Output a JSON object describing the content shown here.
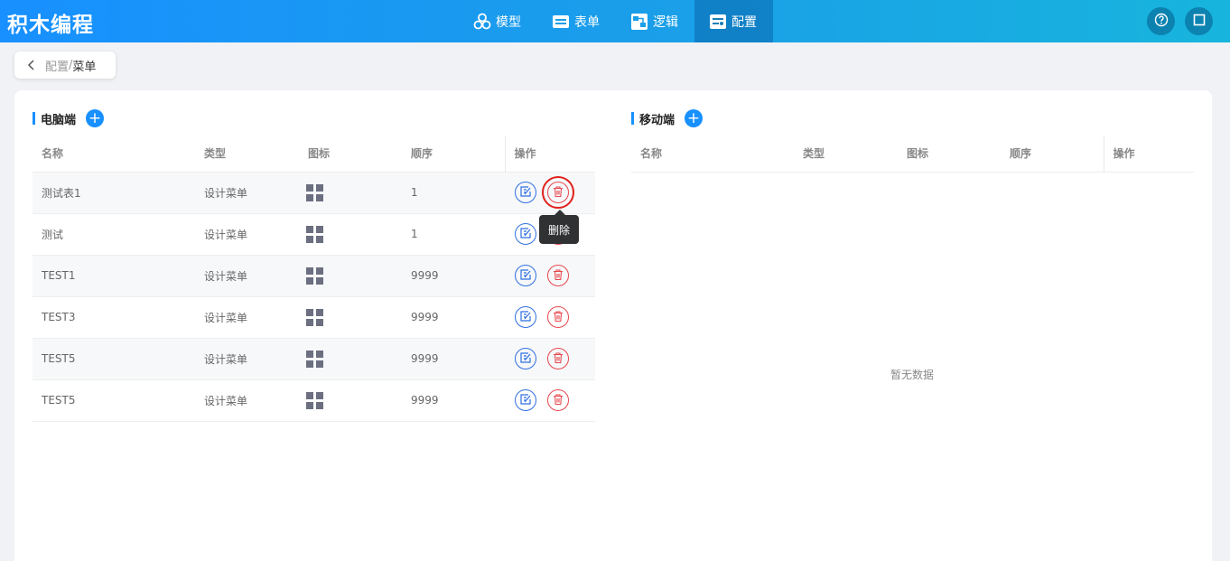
{
  "app": {
    "title": "积木编程"
  },
  "nav": [
    {
      "label": "模型",
      "icon": "cubes-icon"
    },
    {
      "label": "表单",
      "icon": "form-icon"
    },
    {
      "label": "逻辑",
      "icon": "logic-icon"
    },
    {
      "label": "配置",
      "icon": "config-icon",
      "active": true
    }
  ],
  "header_actions": [
    {
      "icon": "help-icon"
    },
    {
      "icon": "square-icon"
    }
  ],
  "breadcrumb": {
    "parent": "配置",
    "separator": "/",
    "current": "菜单"
  },
  "pc": {
    "title": "电脑端",
    "columns": [
      "名称",
      "类型",
      "图标",
      "顺序",
      "操作"
    ],
    "rows": [
      {
        "name": "测试表1",
        "type": "设计菜单",
        "order": "1"
      },
      {
        "name": "测试",
        "type": "设计菜单",
        "order": "1"
      },
      {
        "name": "TEST1",
        "type": "设计菜单",
        "order": "9999"
      },
      {
        "name": "TEST3",
        "type": "设计菜单",
        "order": "9999"
      },
      {
        "name": "TEST5",
        "type": "设计菜单",
        "order": "9999"
      },
      {
        "name": "TEST5",
        "type": "设计菜单",
        "order": "9999"
      }
    ]
  },
  "mobile": {
    "title": "移动端",
    "columns": [
      "名称",
      "类型",
      "图标",
      "顺序",
      "操作"
    ],
    "empty_text": "暂无数据"
  },
  "tooltip": {
    "text": "删除"
  },
  "colors": {
    "primary": "#1890ff",
    "danger": "#e5484d",
    "edit": "#2f6fe0"
  }
}
